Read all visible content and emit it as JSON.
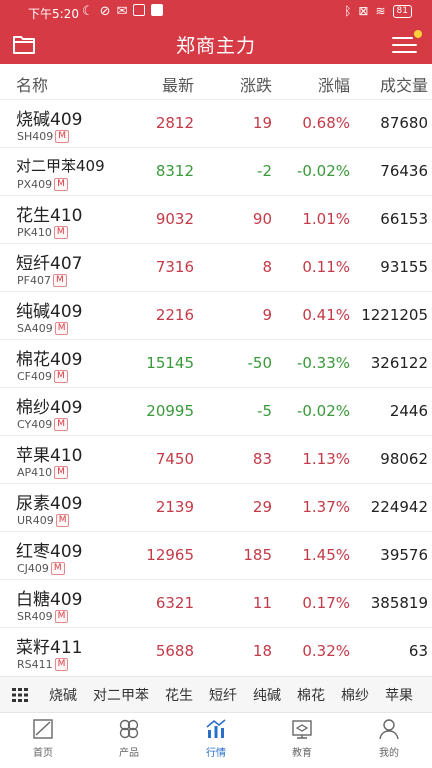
{
  "status_bar": {
    "time": "下午5:20",
    "battery": "81"
  },
  "app_bar": {
    "title": "郑商主力"
  },
  "header": {
    "name": "名称",
    "last": "最新",
    "change": "涨跌",
    "pct": "涨幅",
    "volume": "成交量"
  },
  "rows": [
    {
      "name": "烧碱409",
      "code": "SH409",
      "tag": "M",
      "last": "2812",
      "change": "19",
      "pct": "0.68%",
      "volume": "87680",
      "dir": "up"
    },
    {
      "name": "对二甲苯409",
      "code": "PX409",
      "tag": "M",
      "last": "8312",
      "change": "-2",
      "pct": "-0.02%",
      "volume": "76436",
      "dir": "down"
    },
    {
      "name": "花生410",
      "code": "PK410",
      "tag": "M",
      "last": "9032",
      "change": "90",
      "pct": "1.01%",
      "volume": "66153",
      "dir": "up"
    },
    {
      "name": "短纤407",
      "code": "PF407",
      "tag": "M",
      "last": "7316",
      "change": "8",
      "pct": "0.11%",
      "volume": "93155",
      "dir": "up"
    },
    {
      "name": "纯碱409",
      "code": "SA409",
      "tag": "M",
      "last": "2216",
      "change": "9",
      "pct": "0.41%",
      "volume": "1221205",
      "dir": "up"
    },
    {
      "name": "棉花409",
      "code": "CF409",
      "tag": "M",
      "last": "15145",
      "change": "-50",
      "pct": "-0.33%",
      "volume": "326122",
      "dir": "down"
    },
    {
      "name": "棉纱409",
      "code": "CY409",
      "tag": "M",
      "last": "20995",
      "change": "-5",
      "pct": "-0.02%",
      "volume": "2446",
      "dir": "down"
    },
    {
      "name": "苹果410",
      "code": "AP410",
      "tag": "M",
      "last": "7450",
      "change": "83",
      "pct": "1.13%",
      "volume": "98062",
      "dir": "up"
    },
    {
      "name": "尿素409",
      "code": "UR409",
      "tag": "M",
      "last": "2139",
      "change": "29",
      "pct": "1.37%",
      "volume": "224942",
      "dir": "up"
    },
    {
      "name": "红枣409",
      "code": "CJ409",
      "tag": "M",
      "last": "12965",
      "change": "185",
      "pct": "1.45%",
      "volume": "39576",
      "dir": "up"
    },
    {
      "name": "白糖409",
      "code": "SR409",
      "tag": "M",
      "last": "6321",
      "change": "11",
      "pct": "0.17%",
      "volume": "385819",
      "dir": "up"
    },
    {
      "name": "菜籽411",
      "code": "RS411",
      "tag": "M",
      "last": "5688",
      "change": "18",
      "pct": "0.32%",
      "volume": "63",
      "dir": "up"
    }
  ],
  "category_bar": [
    "烧碱",
    "对二甲苯",
    "花生",
    "短纤",
    "纯碱",
    "棉花",
    "棉纱",
    "苹果"
  ],
  "tabs": [
    {
      "label": "首页",
      "icon": "home-chart-icon"
    },
    {
      "label": "产品",
      "icon": "product-icon"
    },
    {
      "label": "行情",
      "icon": "market-icon",
      "active": true
    },
    {
      "label": "教育",
      "icon": "education-icon"
    },
    {
      "label": "我的",
      "icon": "user-icon"
    }
  ],
  "colors": {
    "brand": "#d63a45",
    "up": "#c33b48",
    "down": "#3a9a3a",
    "active_tab": "#2a6fc9"
  }
}
